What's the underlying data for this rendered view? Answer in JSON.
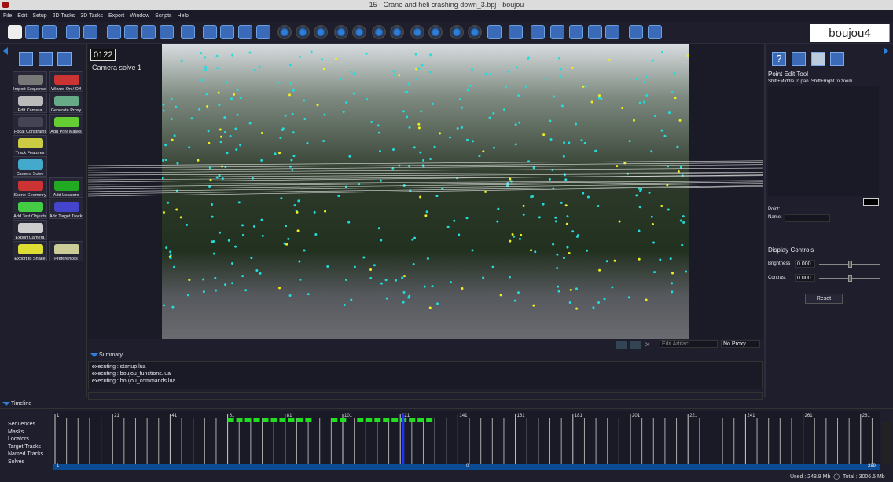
{
  "window": {
    "title": "15 - Crane and heli crashing down_3.bpj - boujou"
  },
  "menu": [
    "File",
    "Edit",
    "Setup",
    "2D Tasks",
    "3D Tasks",
    "Export",
    "Window",
    "Scripts",
    "Help"
  ],
  "logo": "boujou4",
  "viewport": {
    "frame": "0122",
    "solve_label": "Camera solve 1",
    "edit_artifact": "Edit Artifact",
    "proxy": "No Proxy"
  },
  "tools": [
    "Import Sequence",
    "Wizard On / Off",
    "Edit Camera",
    "Generate Proxy",
    "Focal Constraint",
    "Add Poly Masks",
    "Track Features",
    "",
    "Camera Solve",
    "",
    "Scene Geometry",
    "Add Locators",
    "Add Test Objects",
    "Add Target Tracks",
    "Export Camera",
    "",
    "Export to Shake",
    "Preferences"
  ],
  "summary": {
    "title": "Summary",
    "log": [
      "executing : startup.lua",
      "executing : boujou_functions.lua",
      "executing : boujou_commands.lua"
    ]
  },
  "right": {
    "tool_title": "Point Edit Tool",
    "hint": "Shift+Middle to pan. Shift+Right to zoom",
    "point_label": "Point:",
    "name_label": "Name:",
    "display_controls": "Display Controls",
    "brightness_label": "Brightness",
    "brightness": "0.000",
    "contrast_label": "Contrast",
    "contrast": "0.000",
    "reset": "Reset",
    "brightness_level": 0.5,
    "contrast_level": 0.5
  },
  "timeline": {
    "title": "Timeline",
    "tree": [
      "Sequences",
      "Masks",
      "Locators",
      "Target Tracks",
      "Named Tracks",
      "Solves"
    ],
    "tick_labels": [
      "1",
      "21",
      "41",
      "61",
      "81",
      "101",
      "121",
      "141",
      "161",
      "181",
      "201",
      "221",
      "241",
      "261",
      "281"
    ],
    "start": "1",
    "end": "289",
    "current_frame": 122,
    "range_center": "0"
  },
  "status": {
    "used": "Used : 248.8 Mb",
    "total": "Total : 3006.5 Mb"
  },
  "colors": {
    "accent": "#2f7fd8",
    "track_green": "#22dd22",
    "scroll_blue": "#0b4b94"
  }
}
